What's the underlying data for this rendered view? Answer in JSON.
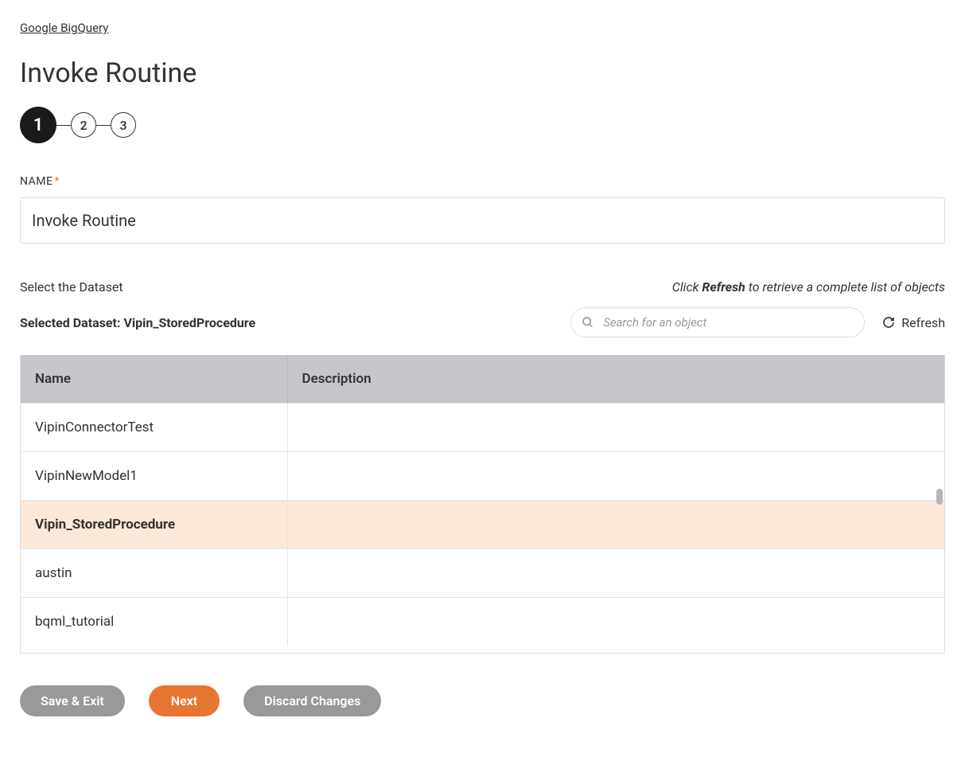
{
  "breadcrumb": "Google BigQuery",
  "pageTitle": "Invoke Routine",
  "stepper": {
    "steps": [
      "1",
      "2",
      "3"
    ],
    "activeIndex": 0
  },
  "nameField": {
    "label": "NAME",
    "value": "Invoke Routine"
  },
  "selectDatasetLabel": "Select the Dataset",
  "refreshHint": {
    "prefix": "Click ",
    "bold": "Refresh",
    "suffix": " to retrieve a complete list of objects"
  },
  "selectedDataset": {
    "prefix": "Selected Dataset: ",
    "value": "Vipin_StoredProcedure"
  },
  "search": {
    "placeholder": "Search for an object"
  },
  "refreshButton": "Refresh",
  "table": {
    "headers": [
      "Name",
      "Description"
    ],
    "rows": [
      {
        "name": "VipinConnectorTest",
        "description": "",
        "selected": false
      },
      {
        "name": "VipinNewModel1",
        "description": "",
        "selected": false
      },
      {
        "name": "Vipin_StoredProcedure",
        "description": "",
        "selected": true
      },
      {
        "name": "austin",
        "description": "",
        "selected": false
      },
      {
        "name": "bqml_tutorial",
        "description": "",
        "selected": false
      }
    ]
  },
  "footer": {
    "saveExit": "Save & Exit",
    "next": "Next",
    "discard": "Discard Changes"
  }
}
